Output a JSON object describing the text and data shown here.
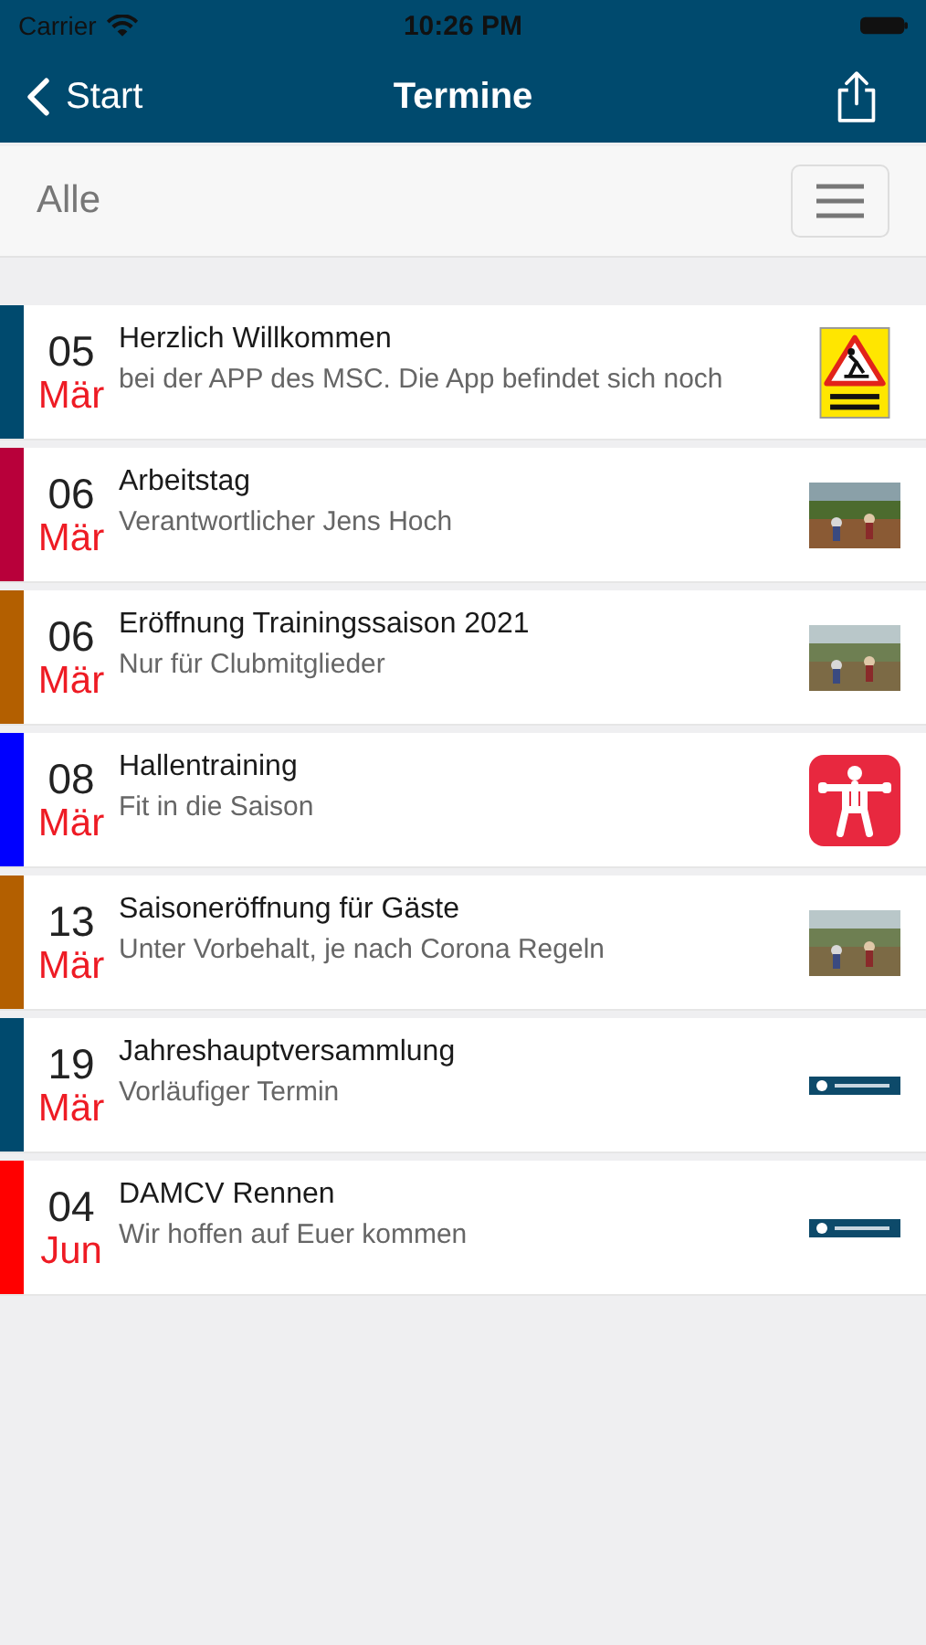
{
  "status_bar": {
    "carrier": "Carrier",
    "time": "10:26 PM"
  },
  "nav": {
    "back": "Start",
    "title": "Termine"
  },
  "filter": {
    "label": "Alle"
  },
  "events": [
    {
      "day": "05",
      "month": "Mär",
      "title": "Herzlich Willkommen",
      "subtitle": "bei der APP des MSC. Die App befindet sich noch",
      "color": "#004a6e",
      "thumb": {
        "kind": "warning-sign"
      }
    },
    {
      "day": "06",
      "month": "Mär",
      "title": "Arbeitstag",
      "subtitle": "Verantwortlicher Jens Hoch",
      "color": "#b8003a"
    },
    {
      "day": "06",
      "month": "Mär",
      "title": "Eröffnung Trainingssaison 2021",
      "subtitle": "Nur für Clubmitglieder",
      "color": "#b35f00"
    },
    {
      "day": "08",
      "month": "Mär",
      "title": "Hallentraining",
      "subtitle": "Fit in die Saison",
      "color": "#0000ff",
      "thumb": {
        "kind": "fitness-icon"
      }
    },
    {
      "day": "13",
      "month": "Mär",
      "title": "Saisoneröffnung für Gäste",
      "subtitle": "Unter Vorbehalt, je nach Corona Regeln",
      "color": "#b35f00"
    },
    {
      "day": "19",
      "month": "Mär",
      "title": "Jahreshauptversammlung",
      "subtitle": "Vorläufiger Termin",
      "color": "#004a6e",
      "thumb": {
        "kind": "logo"
      }
    },
    {
      "day": "04",
      "month": "Jun",
      "title": "DAMCV Rennen",
      "subtitle": "Wir hoffen auf Euer kommen",
      "color": "#ff0000",
      "thumb": {
        "kind": "logo"
      }
    }
  ]
}
